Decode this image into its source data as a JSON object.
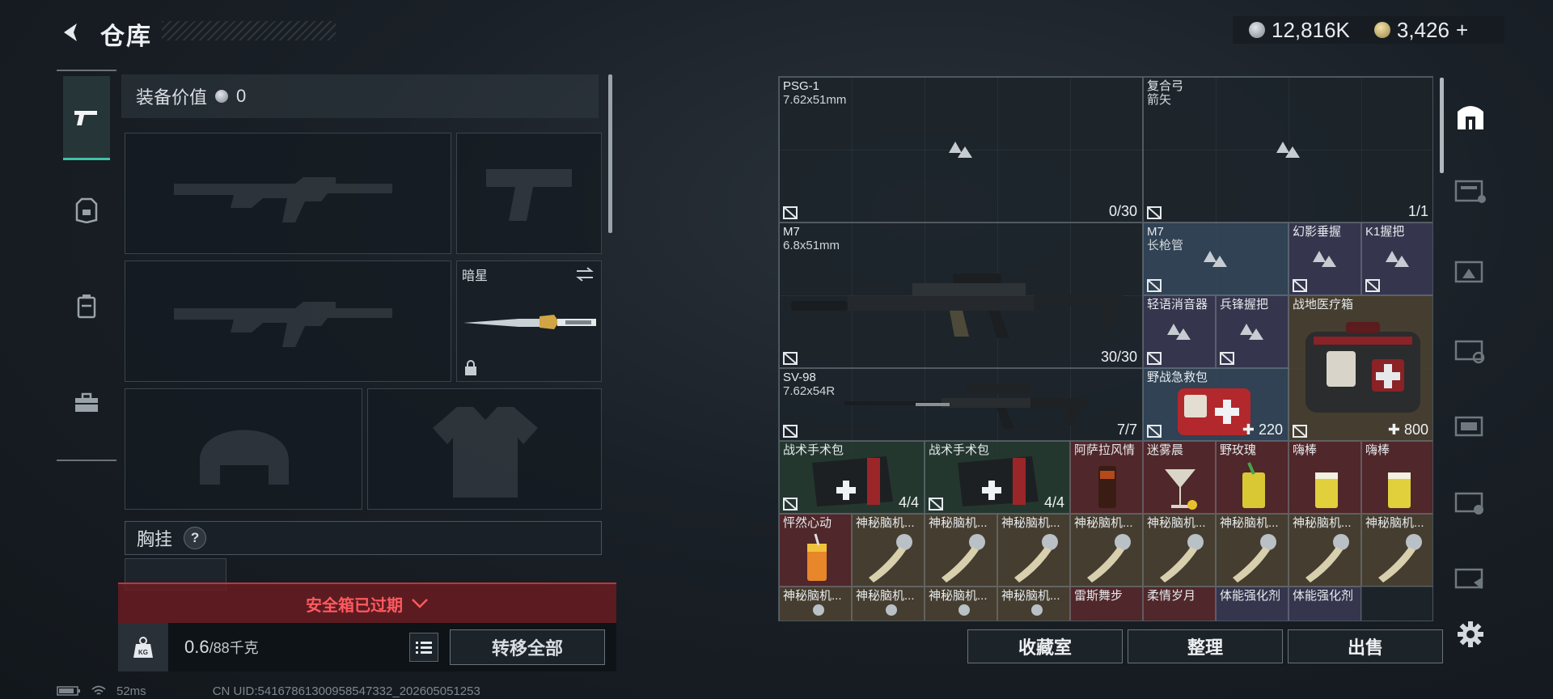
{
  "header": {
    "title": "仓库"
  },
  "currency": {
    "silver": "12,816K",
    "gold": "3,426",
    "add_label": "+"
  },
  "left_rail": {
    "items": [
      "pistol-icon",
      "armor-icon",
      "backpack-icon",
      "toolbox-icon"
    ]
  },
  "loadout": {
    "equip_value_label": "装备价值",
    "equip_value": "0",
    "melee_name": "暗星",
    "chest_label": "胸挂",
    "help": "?"
  },
  "safe_box": {
    "label": "安全箱已过期"
  },
  "weight": {
    "current": "0.6",
    "max_unit": "/88千克",
    "icon_text": "KG"
  },
  "transfer_all": "转移全部",
  "status": {
    "latency": "52ms",
    "uid": "CN UID:54167861300958547332_202605051253"
  },
  "inventory": {
    "items": [
      {
        "name": "PSG-1",
        "sub": "7.62x51mm",
        "count": "0/30"
      },
      {
        "name": "复合弓",
        "sub": "箭矢",
        "count": "1/1"
      },
      {
        "name": "M7",
        "sub": "6.8x51mm",
        "count": "30/30"
      },
      {
        "name": "M7",
        "sub": "长枪管"
      },
      {
        "name": "幻影垂握"
      },
      {
        "name": "K1握把"
      },
      {
        "name": "轻语消音器"
      },
      {
        "name": "兵锋握把"
      },
      {
        "name": "战地医疗箱",
        "count": "800",
        "prefix": "✚"
      },
      {
        "name": "SV-98",
        "sub": "7.62x54R",
        "count": "7/7"
      },
      {
        "name": "野战急救包",
        "count": "220",
        "prefix": "✚"
      },
      {
        "name": "战术手术包",
        "count": "4/4"
      },
      {
        "name": "战术手术包",
        "count": "4/4"
      },
      {
        "name": "阿萨拉风情"
      },
      {
        "name": "迷雾晨"
      },
      {
        "name": "野玫瑰"
      },
      {
        "name": "嗨棒"
      },
      {
        "name": "嗨棒"
      },
      {
        "name": "怦然心动"
      },
      {
        "name": "神秘脑机..."
      },
      {
        "name": "神秘脑机..."
      },
      {
        "name": "神秘脑机..."
      },
      {
        "name": "神秘脑机..."
      },
      {
        "name": "神秘脑机..."
      },
      {
        "name": "神秘脑机..."
      },
      {
        "name": "神秘脑机..."
      },
      {
        "name": "神秘脑机..."
      },
      {
        "name": "神秘脑机..."
      },
      {
        "name": "神秘脑机..."
      },
      {
        "name": "神秘脑机..."
      },
      {
        "name": "神秘脑机..."
      },
      {
        "name": "雷斯舞步"
      },
      {
        "name": "柔情岁月"
      },
      {
        "name": "体能强化剂"
      },
      {
        "name": "体能强化剂"
      }
    ]
  },
  "buttons": {
    "collection": "收藏室",
    "sort": "整理",
    "sell": "出售"
  },
  "right_tabs": [
    "building-icon",
    "gti-tab-icon",
    "gii-tab-icon",
    "v-tab-icon",
    "iv-tab-icon",
    "iv-tab-2-icon",
    "iii-tab-icon"
  ],
  "colors": {
    "accent": "#3fc3a7",
    "warning": "#ff5a5f",
    "rarity_blue": "#34485c",
    "rarity_purple": "#3a3a54",
    "rarity_gold": "#4a4030",
    "rarity_red": "#56282a"
  }
}
